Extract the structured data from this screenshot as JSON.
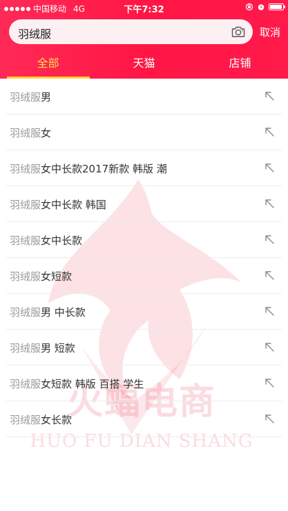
{
  "status_bar": {
    "carrier": "中国移动",
    "network": "4G",
    "time": "下午7:32"
  },
  "search": {
    "value": "羽绒服",
    "camera_icon": "camera-icon",
    "cancel_label": "取消"
  },
  "tabs": [
    {
      "label": "全部",
      "active": true
    },
    {
      "label": "天猫",
      "active": false
    },
    {
      "label": "店铺",
      "active": false
    }
  ],
  "suggestions": [
    {
      "keyword": "羽绒服",
      "suffix": "男"
    },
    {
      "keyword": "羽绒服",
      "suffix": "女"
    },
    {
      "keyword": "羽绒服",
      "suffix": "女中长款2017新款 韩版 潮"
    },
    {
      "keyword": "羽绒服",
      "suffix": "女中长款 韩国"
    },
    {
      "keyword": "羽绒服",
      "suffix": "女中长款"
    },
    {
      "keyword": "羽绒服",
      "suffix": "女短款"
    },
    {
      "keyword": "羽绒服",
      "suffix": "男 中长款"
    },
    {
      "keyword": "羽绒服",
      "suffix": "男 短款"
    },
    {
      "keyword": "羽绒服",
      "suffix": "女短款 韩版 百搭 学生"
    },
    {
      "keyword": "羽绒服",
      "suffix": "女长款"
    }
  ],
  "watermark": {
    "title": "火蝠电商",
    "subtitle": "HUO FU DIAN SHANG"
  },
  "colors": {
    "header": "#ff1a4b",
    "active_tab": "#ffe14a",
    "keyword": "#999999",
    "text": "#333333"
  }
}
